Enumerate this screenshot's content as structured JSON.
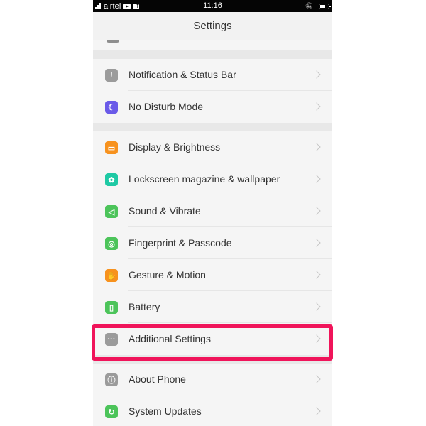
{
  "status_bar": {
    "carrier": "airtel",
    "time": "11:16",
    "icons": [
      "signal-icon",
      "youtube-icon",
      "facebook-icon",
      "alarm-off-icon",
      "battery-icon"
    ]
  },
  "header": {
    "title": "Settings"
  },
  "groups": [
    {
      "items": [
        {
          "label": "Notification & Status Bar",
          "icon": "exclamation-icon",
          "color": "#9b9b9b",
          "glyph": "!"
        },
        {
          "label": "No Disturb Mode",
          "icon": "moon-icon",
          "color": "#6a5ae8",
          "glyph": "☾"
        }
      ]
    },
    {
      "items": [
        {
          "label": "Display & Brightness",
          "icon": "display-icon",
          "color": "#f7921e",
          "glyph": "▭"
        },
        {
          "label": "Lockscreen magazine & wallpaper",
          "icon": "flower-icon",
          "color": "#1ec9a4",
          "glyph": "✿"
        },
        {
          "label": "Sound & Vibrate",
          "icon": "speaker-icon",
          "color": "#4cc45a",
          "glyph": "◁"
        },
        {
          "label": "Fingerprint & Passcode",
          "icon": "fingerprint-icon",
          "color": "#4cc45a",
          "glyph": "◎"
        },
        {
          "label": "Gesture & Motion",
          "icon": "hand-icon",
          "color": "#f7921e",
          "glyph": "✋"
        },
        {
          "label": "Battery",
          "icon": "battery-icon",
          "color": "#4cc45a",
          "glyph": "▯"
        },
        {
          "label": "Additional Settings",
          "icon": "more-icon",
          "color": "#9b9b9b",
          "glyph": "···"
        }
      ]
    },
    {
      "items": [
        {
          "label": "About Phone",
          "icon": "info-icon",
          "color": "#9b9b9b",
          "glyph": "ⓘ"
        },
        {
          "label": "System Updates",
          "icon": "update-icon",
          "color": "#4cc45a",
          "glyph": "↻"
        }
      ]
    }
  ],
  "highlight": {
    "target": "Additional Settings",
    "color": "#f0145a"
  }
}
